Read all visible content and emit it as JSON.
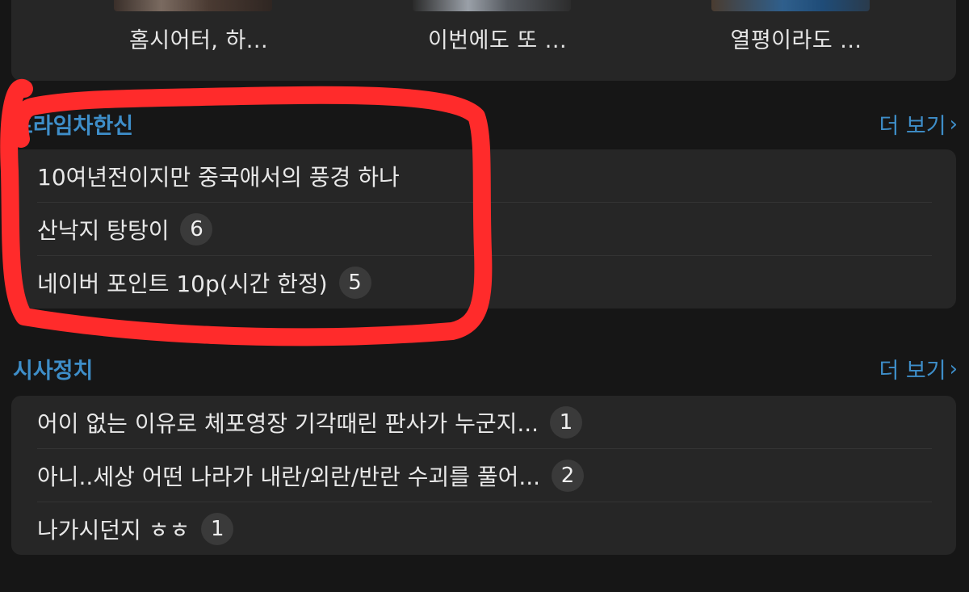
{
  "thumbnails": [
    {
      "title": "홈시어터, 하..."
    },
    {
      "title": "이번에도 또 ..."
    },
    {
      "title": "열평이라도 ..."
    }
  ],
  "sections": [
    {
      "title": "프라임차한신",
      "more_label": "더 보기",
      "items": [
        {
          "title": "10여년전이지만 중국애서의 풍경 하나",
          "count": ""
        },
        {
          "title": "산낙지 탕탕이",
          "count": "6"
        },
        {
          "title": "네이버 포인트 10p(시간 한정)",
          "count": "5"
        }
      ]
    },
    {
      "title": "시사정치",
      "more_label": "더 보기",
      "items": [
        {
          "title": "어이 없는 이유로 체포영장 기각때린 판사가 누군지...",
          "count": "1"
        },
        {
          "title": "아니..세상 어떤 나라가 내란/외란/반란 수괴를 풀어...",
          "count": "2"
        },
        {
          "title": "나가시던지 ㅎㅎ",
          "count": "1"
        }
      ]
    }
  ],
  "colors": {
    "accent": "#3e8ec9",
    "annotation": "#ff2b2b",
    "card": "#262626",
    "background": "#161616"
  }
}
